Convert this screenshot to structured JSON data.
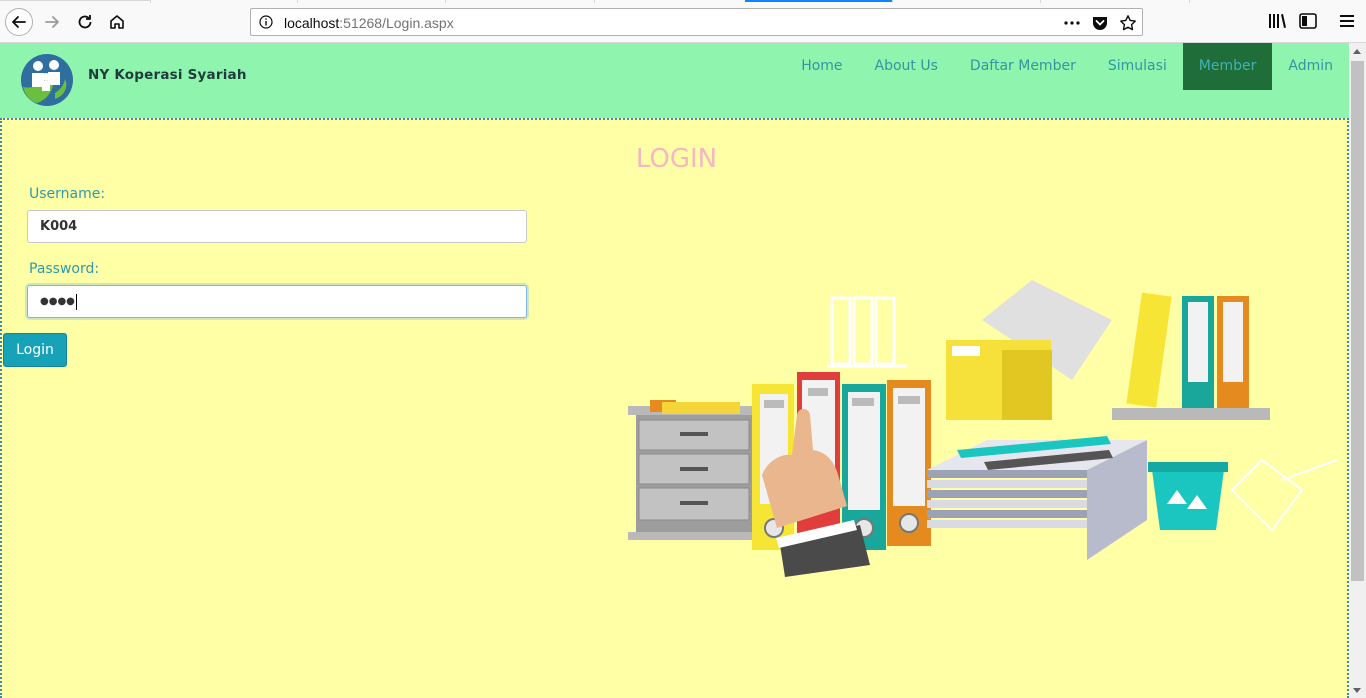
{
  "browser": {
    "url_host": "localhost",
    "url_rest": ":51268/Login.aspx"
  },
  "site": {
    "brand": "NY Koperasi Syariah",
    "nav": [
      "Home",
      "About Us",
      "Daftar Member",
      "Simulasi",
      "Member",
      "Admin"
    ],
    "active_nav": "Member"
  },
  "login": {
    "title": "LOGIN",
    "username_label": "Username:",
    "username_value": "K004",
    "password_label": "Password:",
    "password_value": "●●●●",
    "button_label": "Login"
  },
  "colors": {
    "header_bg": "#8ff4ad",
    "page_bg": "#ffffa6",
    "title": "#f7b6c5",
    "button": "#17a2b8",
    "active_nav_bg": "#1f6e3a"
  }
}
